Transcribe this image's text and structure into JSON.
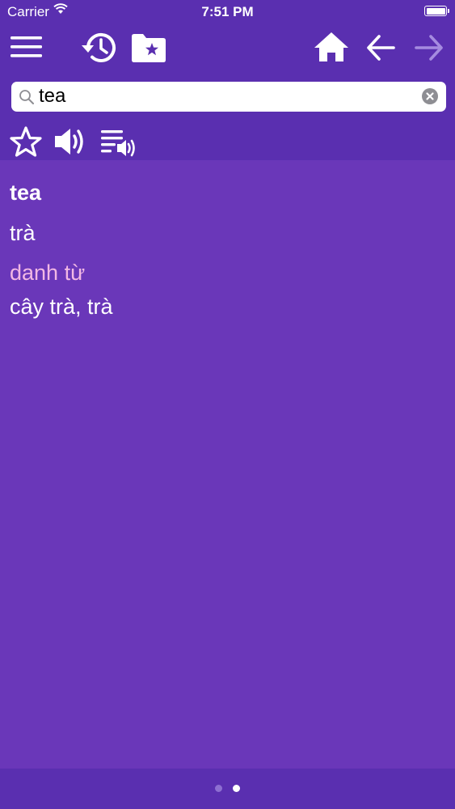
{
  "status_bar": {
    "carrier": "Carrier",
    "time": "7:51 PM"
  },
  "toolbar": {
    "icons": [
      "menu-icon",
      "history-icon",
      "favorites-folder-icon",
      "home-icon",
      "back-arrow-icon",
      "forward-arrow-icon"
    ]
  },
  "search": {
    "value": "tea",
    "placeholder": ""
  },
  "actions": {
    "icons": [
      "star-icon",
      "speaker-icon",
      "playlist-audio-icon"
    ]
  },
  "entry": {
    "headword": "tea",
    "translation": "trà",
    "part_of_speech": "danh từ",
    "meaning": "cây trà, trà"
  },
  "page_indicator": {
    "total": 2,
    "current": 2
  },
  "colors": {
    "background": "#6a37b9",
    "bar": "#5a2fb0",
    "part_of_speech": "#f2b8e4",
    "disabled_arrow": "#a58be0"
  }
}
